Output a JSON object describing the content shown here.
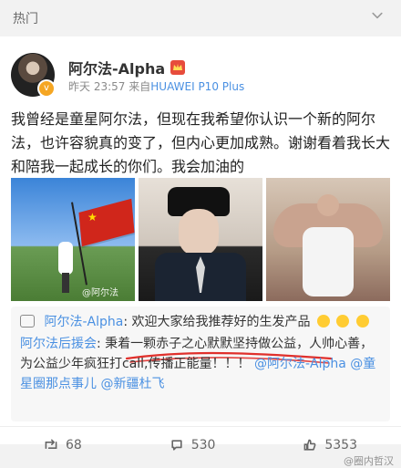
{
  "topbar": {
    "title": "热门"
  },
  "post": {
    "author": {
      "name": "阿尔法-Alpha",
      "verified_badge": "v",
      "badge_color": "#e74c3c"
    },
    "meta": {
      "date": "昨天",
      "time": "23:57",
      "source_prefix": "来自",
      "device": "HUAWEI P10 Plus"
    },
    "text": "我曾经是童星阿尔法，但现在我希望你认识一个新的阿尔法，也许容貌真的变了，但内心更加成熟。谢谢看着我长大和陪我一起成长的你们。我会加油的",
    "photos": [
      {
        "name": "photo-flag",
        "watermark": "@阿尔法"
      },
      {
        "name": "photo-hat"
      },
      {
        "name": "photo-muscle"
      }
    ],
    "comments": [
      {
        "author": "阿尔法-Alpha",
        "sep": ":",
        "text": "欢迎大家给我推荐好的生发产品"
      },
      {
        "author": "阿尔法后援会",
        "sep": ":",
        "text": "秉着一颗赤子之心默默坚持做公益，人帅心善，为公益少年疯狂打call,传播正能量！！！",
        "mentions": [
          "@阿尔法-Alpha",
          "@童星圈那点事儿",
          "@新疆杜飞"
        ]
      }
    ],
    "actions": {
      "repost": "68",
      "comment": "530",
      "like": "5353"
    },
    "watermark": "@圈内哲汉"
  }
}
